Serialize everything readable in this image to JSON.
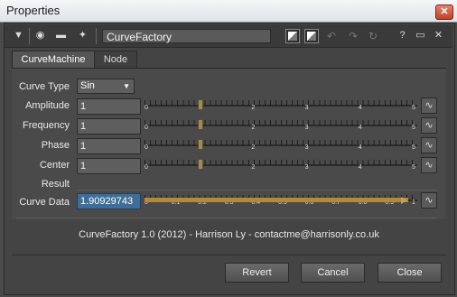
{
  "window": {
    "title": "Properties",
    "close_glyph": "✕"
  },
  "toolbar": {
    "node_name": "CurveFactory",
    "help_glyph": "?",
    "float_glyph": "▭",
    "close_glyph": "✕"
  },
  "tabs": [
    {
      "label": "CurveMachine",
      "active": true
    },
    {
      "label": "Node",
      "active": false
    }
  ],
  "fields": {
    "curve_type": {
      "label": "Curve Type",
      "value": "Sin"
    },
    "amplitude": {
      "label": "Amplitude",
      "value": "1",
      "slider_value": 1,
      "range": [
        0,
        5
      ]
    },
    "frequency": {
      "label": "Frequency",
      "value": "1",
      "slider_value": 1,
      "range": [
        0,
        5
      ]
    },
    "phase": {
      "label": "Phase",
      "value": "1",
      "slider_value": 1,
      "range": [
        0,
        5
      ]
    },
    "center": {
      "label": "Center",
      "value": "1",
      "slider_value": 1,
      "range": [
        0,
        5
      ]
    },
    "result": {
      "label": "Result"
    },
    "curve_data": {
      "label": "Curve Data",
      "value": "1.90929743",
      "slider_value": 1.90929743,
      "range": [
        0,
        1
      ]
    }
  },
  "slider_ticks": {
    "main": [
      "0",
      "1",
      "2",
      "3",
      "4",
      "5"
    ],
    "data": [
      "0",
      "0.1",
      "0.2",
      "0.3",
      "0.4",
      "0.5",
      "0.6",
      "0.7",
      "0.8",
      "0.9",
      "1"
    ]
  },
  "footer": {
    "credit": "CurveFactory 1.0 (2012) - Harrison Ly - contactme@harrisonly.co.uk"
  },
  "buttons": {
    "revert": "Revert",
    "cancel": "Cancel",
    "close": "Close"
  },
  "icons": {
    "curve": "∿"
  }
}
